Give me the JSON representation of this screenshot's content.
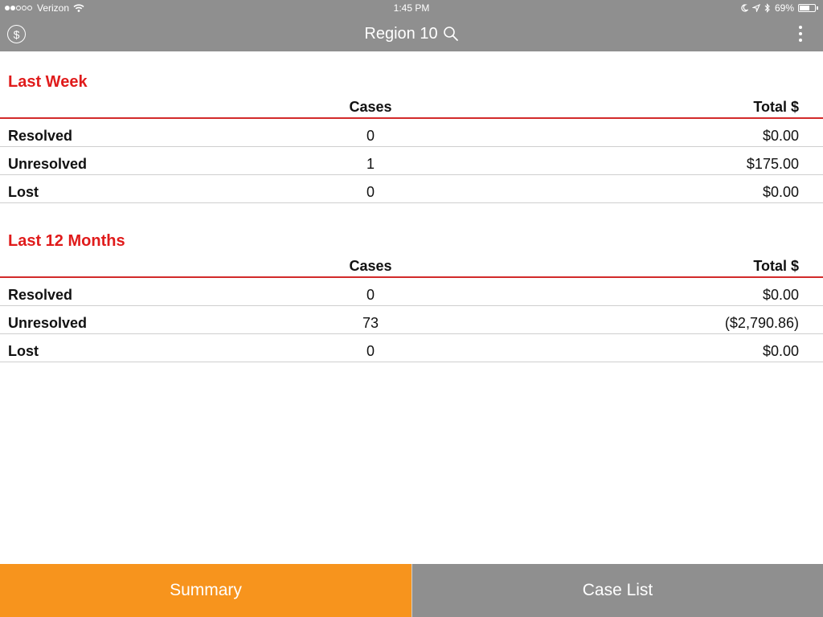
{
  "status_bar": {
    "carrier": "Verizon",
    "signal_bars_filled": 2,
    "signal_bars_total": 5,
    "time": "1:45 PM",
    "battery_percent": "69%",
    "battery_level": 0.69,
    "icons": [
      "wifi-icon",
      "moon-icon",
      "location-arrow-icon",
      "bluetooth-icon",
      "battery-icon"
    ]
  },
  "nav": {
    "title": "Region 10",
    "left_icon": "dollar-circle-icon",
    "title_icon": "search-icon",
    "right_icon": "more-vertical-icon",
    "dollar_glyph": "$"
  },
  "colors": {
    "bar_grey": "#8f8f8f",
    "section_red": "#e01b1b",
    "accent_orange": "#f7941d"
  },
  "sections": [
    {
      "title": "Last Week",
      "headers": {
        "label": "",
        "cases": "Cases",
        "total": "Total $"
      },
      "rows": [
        {
          "label": "Resolved",
          "cases": "0",
          "total": "$0.00"
        },
        {
          "label": "Unresolved",
          "cases": "1",
          "total": "$175.00"
        },
        {
          "label": "Lost",
          "cases": "0",
          "total": "$0.00"
        }
      ]
    },
    {
      "title": "Last 12 Months",
      "headers": {
        "label": "",
        "cases": "Cases",
        "total": "Total $"
      },
      "rows": [
        {
          "label": "Resolved",
          "cases": "0",
          "total": "$0.00"
        },
        {
          "label": "Unresolved",
          "cases": "73",
          "total": "($2,790.86)"
        },
        {
          "label": "Lost",
          "cases": "0",
          "total": "$0.00"
        }
      ]
    }
  ],
  "tabs": [
    {
      "label": "Summary",
      "active": true
    },
    {
      "label": "Case List",
      "active": false
    }
  ]
}
